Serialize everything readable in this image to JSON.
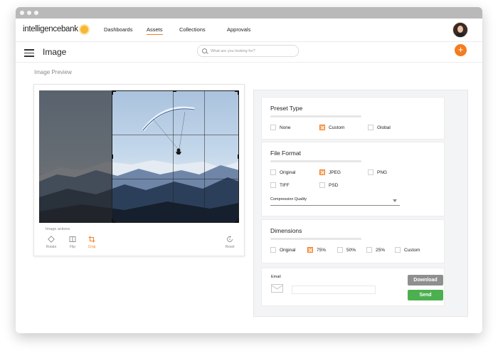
{
  "brand": {
    "name": "intelligencebank",
    "accent": "#f47c20"
  },
  "nav": {
    "links": [
      {
        "label": "Dashboards",
        "active": false
      },
      {
        "label": "Assets",
        "active": true
      },
      {
        "label": "Collections",
        "active": false
      },
      {
        "label": "Approvals",
        "active": false
      }
    ]
  },
  "header": {
    "title": "Image",
    "search_placeholder": "What are you looking for?",
    "add_label": "+"
  },
  "preview": {
    "section_title": "Image Preview",
    "actions_label": "Image actions",
    "actions": [
      {
        "label": "Rotate",
        "icon": "rotate-icon",
        "active": false
      },
      {
        "label": "Flip",
        "icon": "flip-icon",
        "active": false
      },
      {
        "label": "Crop",
        "icon": "crop-icon",
        "active": true
      },
      {
        "label": "Reset",
        "icon": "reset-icon",
        "active": false
      }
    ]
  },
  "preset": {
    "title": "Preset Type",
    "options": [
      {
        "label": "None",
        "checked": false
      },
      {
        "label": "Custom",
        "checked": true
      },
      {
        "label": "Global",
        "checked": false
      }
    ]
  },
  "format": {
    "title": "File Format",
    "options": [
      {
        "label": "Original",
        "checked": false
      },
      {
        "label": "JPEG",
        "checked": true
      },
      {
        "label": "PNG",
        "checked": false
      },
      {
        "label": "TIFF",
        "checked": false
      },
      {
        "label": "PSD",
        "checked": false
      }
    ],
    "compression_label": "Compression Quality"
  },
  "dimensions": {
    "title": "Dimensions",
    "options": [
      {
        "label": "Original",
        "checked": false
      },
      {
        "label": "75%",
        "checked": true
      },
      {
        "label": "50%",
        "checked": false
      },
      {
        "label": "25%",
        "checked": false
      },
      {
        "label": "Custom",
        "checked": false
      }
    ]
  },
  "email": {
    "label": "Email",
    "value": "",
    "download_label": "Download",
    "send_label": "Send"
  }
}
